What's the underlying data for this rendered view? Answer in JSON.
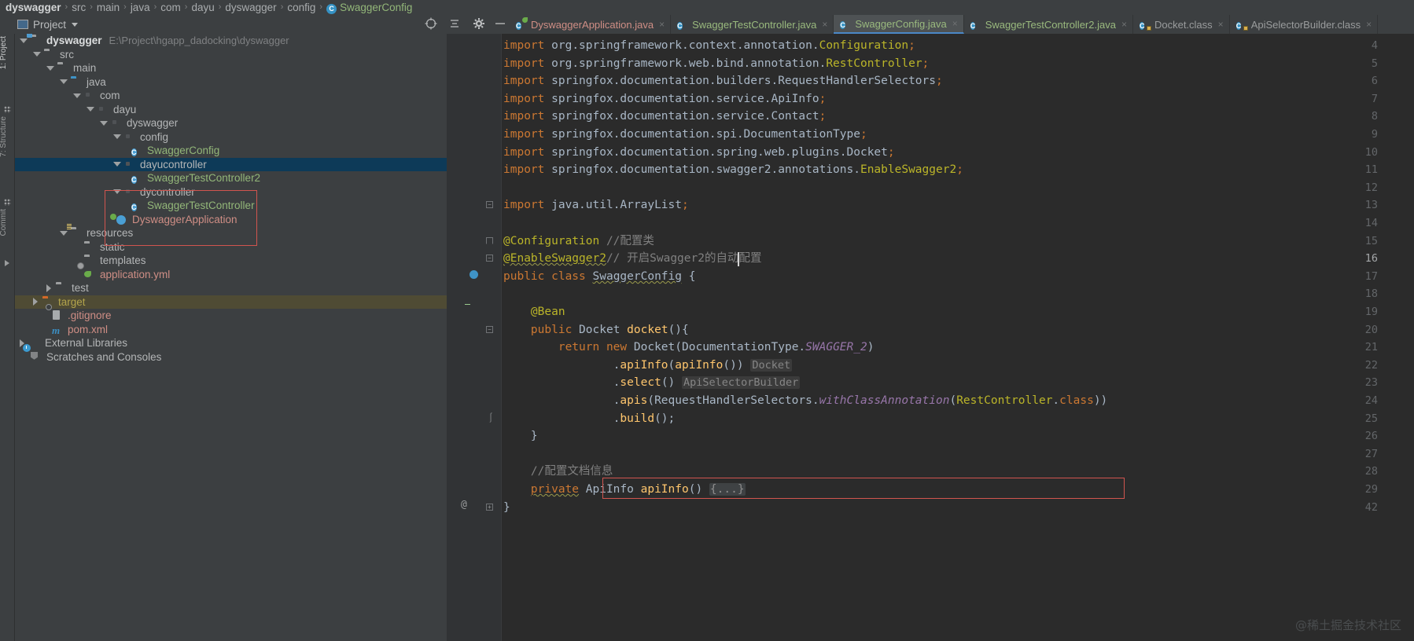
{
  "breadcrumb": {
    "items": [
      {
        "label": "dyswagger",
        "style": "first"
      },
      {
        "label": "src",
        "style": "plain"
      },
      {
        "label": "main",
        "style": "plain"
      },
      {
        "label": "java",
        "style": "plain"
      },
      {
        "label": "com",
        "style": "plain"
      },
      {
        "label": "dayu",
        "style": "plain"
      },
      {
        "label": "dyswagger",
        "style": "plain"
      },
      {
        "label": "config",
        "style": "plain"
      },
      {
        "label": "SwaggerConfig",
        "style": "leaf",
        "icon": "class-icon"
      }
    ],
    "separator": "›",
    "class_badge": "C"
  },
  "toolbar": {
    "project_label": "Project",
    "project_icon": "project-window-icon",
    "icons": [
      {
        "name": "scroll-from-source-icon",
        "glyph": "⊕"
      },
      {
        "name": "collapse-all-icon",
        "glyph": "≃"
      },
      {
        "name": "settings-gear-icon",
        "glyph": "⚙"
      },
      {
        "name": "hide-window-icon",
        "glyph": "—"
      }
    ]
  },
  "stripe": {
    "project": "1: Project",
    "structure": "7: Structure",
    "commit": "Commit"
  },
  "tabs": [
    {
      "label": "DyswaggerApplication.java",
      "color": "red",
      "icon": "spring-boot-class-icon",
      "active": false,
      "close": "×"
    },
    {
      "label": "SwaggerTestController.java",
      "color": "green",
      "icon": "class-icon",
      "active": false,
      "close": "×"
    },
    {
      "label": "SwaggerConfig.java",
      "color": "green",
      "icon": "class-icon",
      "active": true,
      "close": "×"
    },
    {
      "label": "SwaggerTestController2.java",
      "color": "green",
      "icon": "class-icon",
      "active": false,
      "close": "×"
    },
    {
      "label": "Docket.class",
      "color": "grey",
      "icon": "class-file-icon",
      "active": false,
      "close": "×"
    },
    {
      "label": "ApiSelectorBuilder.class",
      "color": "grey",
      "icon": "class-file-icon",
      "active": false,
      "close": "×"
    }
  ],
  "tree": [
    {
      "label": "dyswagger",
      "path": "E:\\Project\\hgapp_dadocking\\dyswagger",
      "depth": 0,
      "arrow": "open",
      "icon": "module-folder-icon",
      "style": "bold"
    },
    {
      "label": "src",
      "depth": 1,
      "arrow": "open",
      "icon": "folder-icon",
      "style": "plain"
    },
    {
      "label": "main",
      "depth": 2,
      "arrow": "open",
      "icon": "folder-icon",
      "style": "plain"
    },
    {
      "label": "java",
      "depth": 3,
      "arrow": "open",
      "icon": "source-folder-icon",
      "style": "plain"
    },
    {
      "label": "com",
      "depth": 4,
      "arrow": "open",
      "icon": "package-icon",
      "style": "plain"
    },
    {
      "label": "dayu",
      "depth": 5,
      "arrow": "open",
      "icon": "package-icon",
      "style": "plain"
    },
    {
      "label": "dyswagger",
      "depth": 6,
      "arrow": "open",
      "icon": "package-icon",
      "style": "plain"
    },
    {
      "label": "config",
      "depth": 7,
      "arrow": "open",
      "icon": "package-icon",
      "style": "plain"
    },
    {
      "label": "SwaggerConfig",
      "depth": 8,
      "arrow": "none",
      "icon": "class-icon",
      "style": "green"
    },
    {
      "label": "dayucontroller",
      "depth": 7,
      "arrow": "open",
      "icon": "package-icon",
      "style": "plain",
      "selected": true
    },
    {
      "label": "SwaggerTestController2",
      "depth": 8,
      "arrow": "none",
      "icon": "class-icon",
      "style": "green"
    },
    {
      "label": "dycontroller",
      "depth": 7,
      "arrow": "open",
      "icon": "package-icon",
      "style": "plain"
    },
    {
      "label": "SwaggerTestController",
      "depth": 8,
      "arrow": "none",
      "icon": "class-icon",
      "style": "green"
    },
    {
      "label": "DyswaggerApplication",
      "depth": 7,
      "arrow": "none",
      "icon": "spring-boot-class-icon",
      "style": "red"
    },
    {
      "label": "resources",
      "depth": 3,
      "arrow": "open",
      "icon": "resource-folder-icon",
      "style": "plain"
    },
    {
      "label": "static",
      "depth": 4,
      "arrow": "none",
      "icon": "folder-icon",
      "style": "plain"
    },
    {
      "label": "templates",
      "depth": 4,
      "arrow": "none",
      "icon": "folder-icon",
      "style": "plain"
    },
    {
      "label": "application.yml",
      "depth": 4,
      "arrow": "none",
      "icon": "spring-yaml-icon",
      "style": "red"
    },
    {
      "label": "test",
      "depth": 2,
      "arrow": "closed",
      "icon": "folder-icon",
      "style": "plain"
    },
    {
      "label": "target",
      "depth": 1,
      "arrow": "closed",
      "icon": "excluded-folder-icon",
      "style": "olive",
      "highlighted": true
    },
    {
      "label": ".gitignore",
      "depth": 1,
      "arrow": "none",
      "icon": "ignored-file-icon",
      "style": "red"
    },
    {
      "label": "pom.xml",
      "depth": 1,
      "arrow": "none",
      "icon": "maven-icon",
      "style": "red"
    },
    {
      "label": "External Libraries",
      "depth": 0,
      "arrow": "closed",
      "icon": "libraries-icon",
      "style": "plain"
    },
    {
      "label": "Scratches and Consoles",
      "depth": 0,
      "arrow": "none",
      "icon": "scratches-icon",
      "style": "plain"
    }
  ],
  "editor": {
    "file": "SwaggerConfig.java",
    "line_numbers": [
      "4",
      "5",
      "6",
      "7",
      "8",
      "9",
      "10",
      "11",
      "12",
      "13",
      "14",
      "15",
      "16",
      "17",
      "18",
      "19",
      "20",
      "21",
      "22",
      "23",
      "24",
      "25",
      "26",
      "27",
      "28",
      "29",
      "42"
    ],
    "current_line": "16",
    "at_marker": "@",
    "inlay_hints": [
      "Docket",
      "ApiSelectorBuilder"
    ],
    "folded_body": "{...}",
    "lines": [
      {
        "num": "4",
        "text": "import org.springframework.context.annotation.Configuration;"
      },
      {
        "num": "5",
        "text": "import org.springframework.web.bind.annotation.RestController;"
      },
      {
        "num": "6",
        "text": "import springfox.documentation.builders.RequestHandlerSelectors;"
      },
      {
        "num": "7",
        "text": "import springfox.documentation.service.ApiInfo;"
      },
      {
        "num": "8",
        "text": "import springfox.documentation.service.Contact;"
      },
      {
        "num": "9",
        "text": "import springfox.documentation.spi.DocumentationType;"
      },
      {
        "num": "10",
        "text": "import springfox.documentation.spring.web.plugins.Docket;"
      },
      {
        "num": "11",
        "text": "import springfox.documentation.swagger2.annotations.EnableSwagger2;"
      },
      {
        "num": "12",
        "text": ""
      },
      {
        "num": "13",
        "text": "import java.util.ArrayList;"
      },
      {
        "num": "14",
        "text": ""
      },
      {
        "num": "15",
        "text": "@Configuration //配置类"
      },
      {
        "num": "16",
        "text": "@EnableSwagger2// 开启Swagger2的自动配置"
      },
      {
        "num": "17",
        "text": "public class SwaggerConfig {"
      },
      {
        "num": "18",
        "text": ""
      },
      {
        "num": "19",
        "text": "    @Bean"
      },
      {
        "num": "20",
        "text": "    public Docket docket(){"
      },
      {
        "num": "21",
        "text": "        return new Docket(DocumentationType.SWAGGER_2)"
      },
      {
        "num": "22",
        "text": "                .apiInfo(apiInfo()) Docket"
      },
      {
        "num": "23",
        "text": "                .select() ApiSelectorBuilder"
      },
      {
        "num": "24",
        "text": "                .apis(RequestHandlerSelectors.withClassAnnotation(RestController.class))"
      },
      {
        "num": "25",
        "text": "                .build();"
      },
      {
        "num": "26",
        "text": "    }"
      },
      {
        "num": "27",
        "text": ""
      },
      {
        "num": "28",
        "text": "    //配置文档信息"
      },
      {
        "num": "29",
        "text": "    private ApiInfo apiInfo() {...}"
      },
      {
        "num": "42",
        "text": "}"
      }
    ]
  },
  "annotations": {
    "tree_highlight_box": "#d1554f",
    "code_highlight_box": "#d1554f"
  },
  "watermark": "@稀土掘金技术社区",
  "colors": {
    "background": "#3c3f41",
    "editor_background": "#2b2b2b",
    "accent_blue": "#4a88c7",
    "selection": "#0d3a58",
    "keyword": "#cc7832",
    "annotation": "#bbb529",
    "string": "#6a8759",
    "comment": "#808080",
    "static_field": "#9876aa",
    "method": "#ffc66d",
    "highlight_red": "#d1554f"
  }
}
